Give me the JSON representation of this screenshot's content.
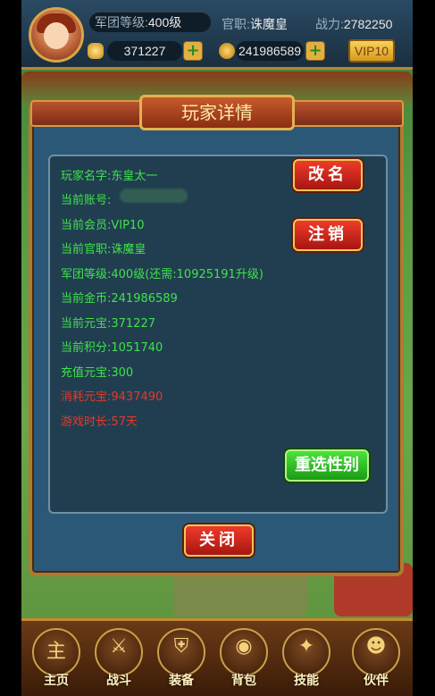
{
  "header": {
    "legion_level_label": "军团等级:",
    "legion_level_value": "400级",
    "official_label": "官职:",
    "official_value": "诛魔皇",
    "power_label": "战力:",
    "power_value": "2782250",
    "yuanbao": "371227",
    "gold": "241986589",
    "vip": "VIP10"
  },
  "dialog": {
    "title": "玩家详情",
    "rows": [
      {
        "label": "玩家名字:",
        "value": "东皇太一"
      },
      {
        "label": "当前账号:",
        "value": ""
      },
      {
        "label": "当前会员:",
        "value": "VIP10"
      },
      {
        "label": "当前官职:",
        "value": "诛魔皇"
      },
      {
        "label": "军团等级:",
        "value": "400级(还需:10925191升级)"
      },
      {
        "label": "当前金币:",
        "value": "241986589"
      },
      {
        "label": "当前元宝:",
        "value": "371227"
      },
      {
        "label": "当前积分:",
        "value": "1051740"
      },
      {
        "label": "充值元宝:",
        "value": "300"
      },
      {
        "label": "消耗元宝:",
        "value": "9437490"
      },
      {
        "label": "游戏时长:",
        "value": "57天"
      }
    ],
    "rename_button": "改名",
    "logout_button": "注销",
    "reselect_gender_button": "重选性别",
    "close_button": "关闭"
  },
  "nav": {
    "items": [
      {
        "label": "主页",
        "glyph": "主"
      },
      {
        "label": "战斗",
        "glyph": "⚔"
      },
      {
        "label": "装备",
        "glyph": "⛨"
      },
      {
        "label": "背包",
        "glyph": "◉"
      },
      {
        "label": "技能",
        "glyph": "✦"
      },
      {
        "label": "伙伴",
        "glyph": "☻"
      }
    ]
  },
  "colors": {
    "green_text": "#3fe24a",
    "red_text": "#e23a2a",
    "dialog_bg": "#2c5878"
  }
}
